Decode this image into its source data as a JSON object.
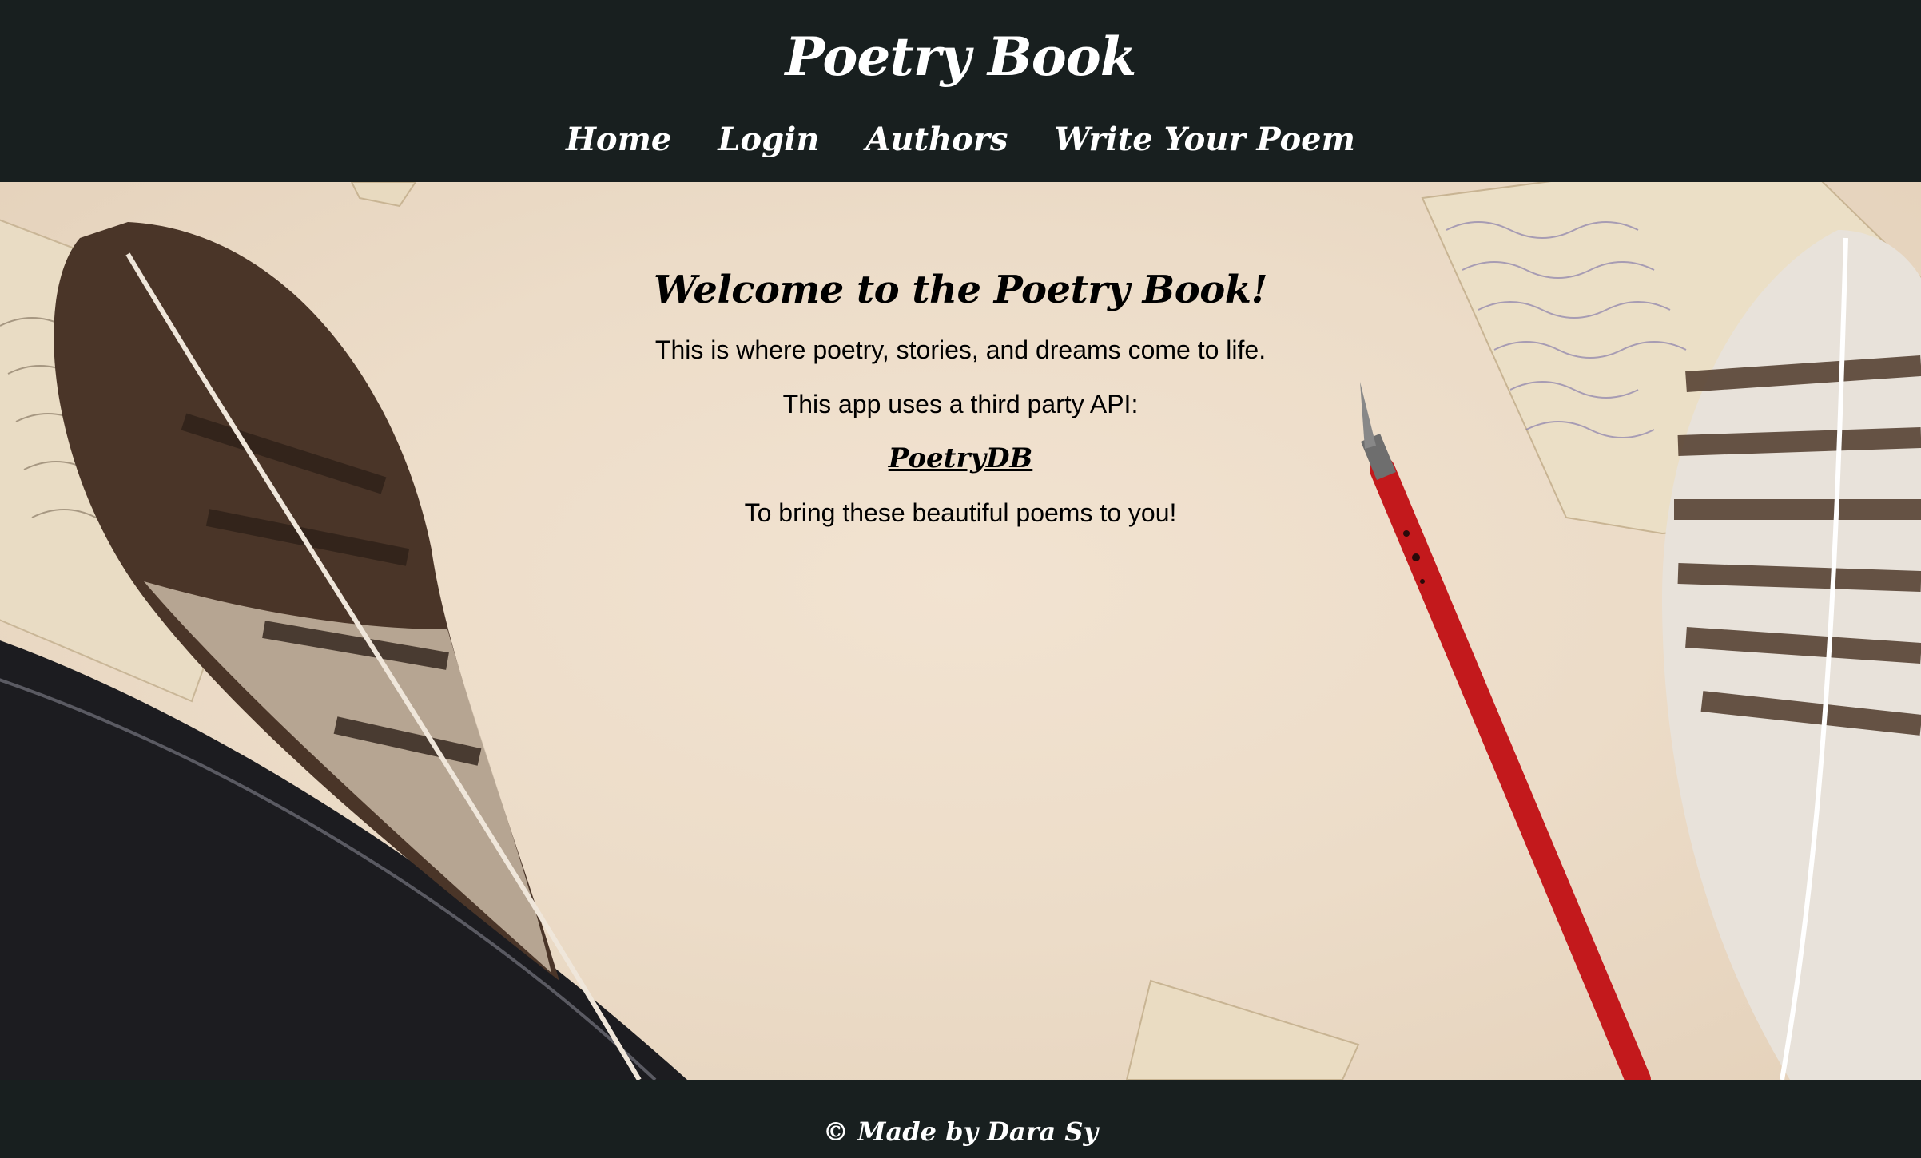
{
  "header": {
    "title": "Poetry Book",
    "nav": [
      {
        "label": "Home"
      },
      {
        "label": "Login"
      },
      {
        "label": "Authors"
      },
      {
        "label": "Write Your Poem"
      }
    ]
  },
  "main": {
    "heading": "Welcome to the Poetry Book!",
    "line1": "This is where poetry, stories, and dreams come to life.",
    "line2": "This app uses a third party API:",
    "api_link": "PoetryDB",
    "line3": "To bring these beautiful poems to you!"
  },
  "footer": {
    "text": "© Made by Dara Sy"
  },
  "colors": {
    "header_bg": "#181f1f",
    "header_text": "#ffffff",
    "paper": "#efe1cf",
    "pen_red": "#c3191c"
  },
  "background": {
    "description_icons": [
      "feather-icon",
      "fountain-pen-icon",
      "letter-icon"
    ]
  }
}
